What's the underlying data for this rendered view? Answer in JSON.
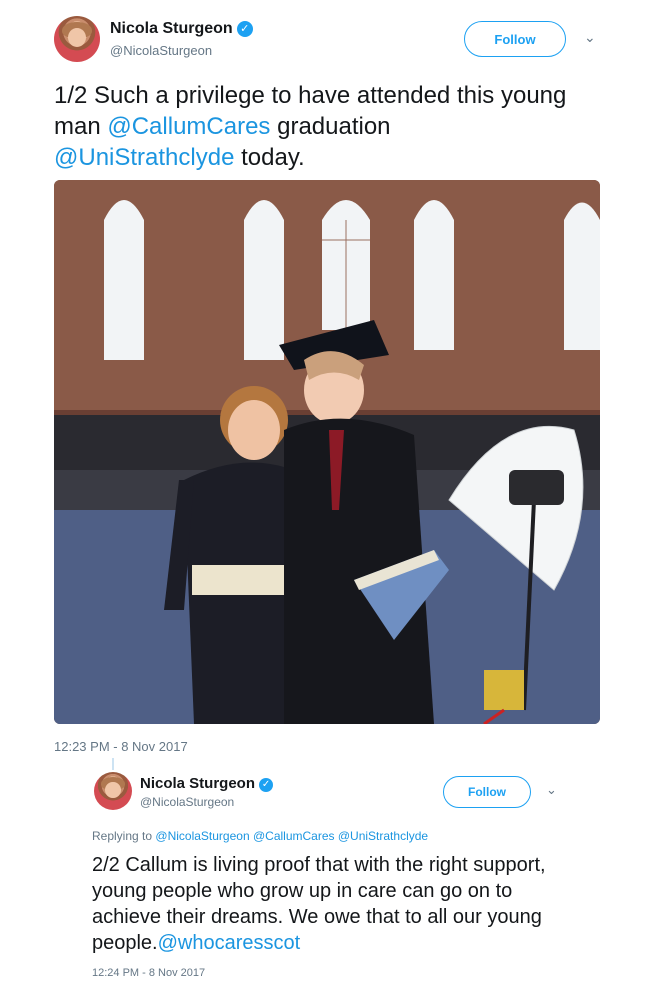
{
  "tweet1": {
    "author_name": "Nicola Sturgeon",
    "author_handle": "@NicolaSturgeon",
    "follow_label": "Follow",
    "text_pre": "1/2 Such a privilege to have attended this young man ",
    "mention1": "@CallumCares",
    "text_mid": " graduation ",
    "mention2": "@UniStrathclyde",
    "text_post": " today.",
    "timestamp": "12:23 PM - 8 Nov 2017"
  },
  "tweet2": {
    "author_name": "Nicola Sturgeon",
    "author_handle": "@NicolaSturgeon",
    "follow_label": "Follow",
    "replying_to_label": "Replying to",
    "replying_to": [
      "@NicolaSturgeon",
      "@CallumCares",
      "@UniStrathclyde"
    ],
    "text": "2/2 Callum is living proof that with the right support, young people who grow up in care can go on to achieve their dreams. We owe that to all our young people.",
    "mention": "@whocaresscot",
    "timestamp": "12:24 PM - 8 Nov 2017"
  },
  "icons": {
    "verified": "verified-badge-icon",
    "menu": "chevron-down-icon"
  },
  "colors": {
    "link": "#1b95e0",
    "follow_border": "#1da1f2",
    "muted": "#657786",
    "text": "#14171a"
  }
}
